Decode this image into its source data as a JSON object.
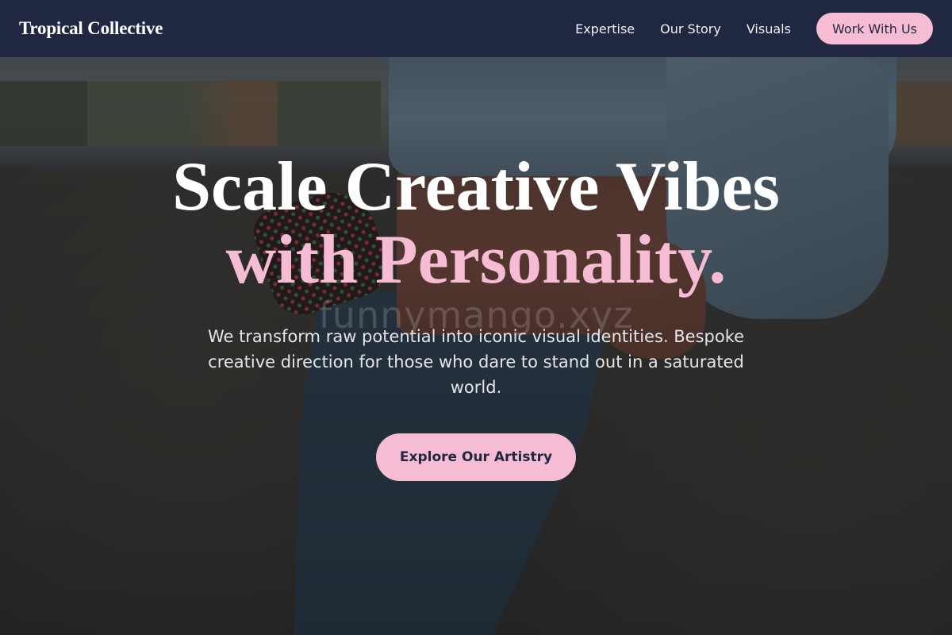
{
  "nav": {
    "brand": "Tropical Collective",
    "links": [
      "Expertise",
      "Our Story",
      "Visuals"
    ],
    "cta_label": "Work With Us"
  },
  "hero": {
    "headline_line1": "Scale Creative Vibes",
    "headline_line2": "with Personality.",
    "watermark": "funnymango.xyz",
    "subtext": "We transform raw potential into iconic visual identities. Bespoke creative direction for those who dare to stand out in a saturated world.",
    "cta_label": "Explore Our Artistry"
  },
  "colors": {
    "nav_background": "#1f2840",
    "accent_pink": "#f6bcd4",
    "headline_white": "#ffffff"
  }
}
